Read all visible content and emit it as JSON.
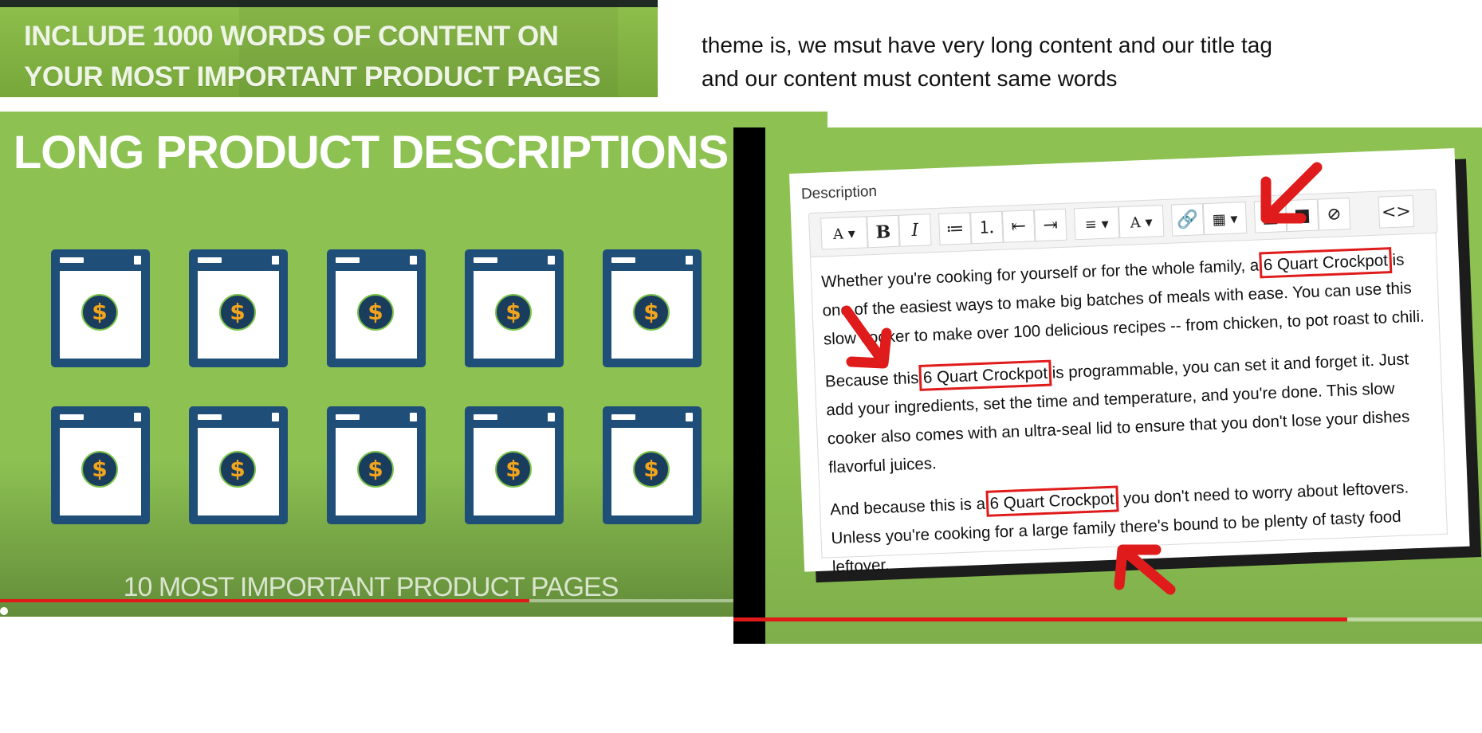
{
  "banner": {
    "line1": "INCLUDE 1000 WORDS OF CONTENT ON",
    "line2": "YOUR MOST IMPORTANT PRODUCT PAGES"
  },
  "note": {
    "text": "theme is, we msut have very long content and our title tag\nand our content must content same words"
  },
  "left_video": {
    "title": "LONG PRODUCT DESCRIPTIONS",
    "subtitle": "10 MOST IMPORTANT PRODUCT PAGES",
    "card_symbol": "$",
    "progress": 0.64,
    "colors": {
      "background": "#8dc253",
      "card": "#1f4e78",
      "coin": "#f2a51c",
      "progress": "#e01919"
    }
  },
  "right_video": {
    "field_label": "Description",
    "toolbar": [
      {
        "icon": "font-icon",
        "label": "A ▾"
      },
      {
        "icon": "bold-icon",
        "label": "B"
      },
      {
        "icon": "italic-icon",
        "label": "I"
      },
      {
        "icon": "bullet-list-icon",
        "label": "≔"
      },
      {
        "icon": "numbered-list-icon",
        "label": "⒈"
      },
      {
        "icon": "outdent-icon",
        "label": "⇤"
      },
      {
        "icon": "indent-icon",
        "label": "⇥"
      },
      {
        "icon": "align-icon",
        "label": "≡ ▾"
      },
      {
        "icon": "text-color-icon",
        "label": "A ▾"
      },
      {
        "icon": "link-icon",
        "label": "🔗"
      },
      {
        "icon": "table-icon",
        "label": "▦ ▾"
      },
      {
        "icon": "image-icon",
        "label": "▣"
      },
      {
        "icon": "video-icon",
        "label": "■"
      },
      {
        "icon": "clear-format-icon",
        "label": "⊘"
      },
      {
        "icon": "code-view-icon",
        "label": "<>"
      }
    ],
    "keyword": "6 Quart Crockpot",
    "p1_before": "Whether you're cooking for yourself or for the whole family, a ",
    "p1_after": " is one of the easiest ways to make big batches of meals with ease. You can use this slow cooker to make over 100 delicious recipes -- from chicken, to pot roast to chili.",
    "p2_before": "Because this ",
    "p2_after": " is programmable, you can set it and forget it. Just add your ingredients, set the time and temperature, and you're done. This slow cooker also comes with an ultra-seal lid to ensure that you don't lose your dishes flavorful juices.",
    "p3_before": "And because this is a ",
    "p3_after": ", you don't need to worry about leftovers. Unless you're cooking for a large family there's bound to be plenty of tasty food leftover.",
    "progress": 0.82,
    "colors": {
      "highlight": "#e01b1b",
      "arrow": "#e01b1b"
    }
  }
}
